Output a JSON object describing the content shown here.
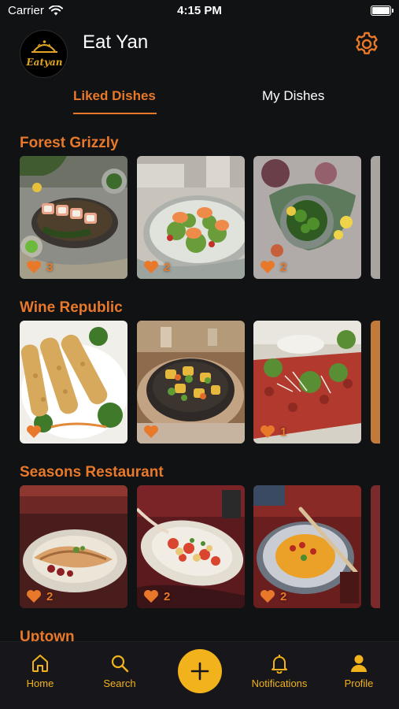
{
  "status_bar": {
    "carrier": "Carrier",
    "time": "4:15 PM"
  },
  "header": {
    "title": "Eat Yan",
    "logo_text": "Eatyan"
  },
  "tabs": [
    {
      "label": "Liked Dishes",
      "active": true
    },
    {
      "label": "My Dishes",
      "active": false
    }
  ],
  "sections": [
    {
      "name": "Forest Grizzly",
      "cards": [
        {
          "likes": "3"
        },
        {
          "likes": "2"
        },
        {
          "likes": "2"
        }
      ]
    },
    {
      "name": "Wine Republic",
      "cards": [
        {
          "likes": ""
        },
        {
          "likes": ""
        },
        {
          "likes": "1"
        }
      ]
    },
    {
      "name": "Seasons Restaurant",
      "cards": [
        {
          "likes": "2"
        },
        {
          "likes": "2"
        },
        {
          "likes": "2"
        }
      ]
    },
    {
      "name": "Uptown",
      "cards": []
    }
  ],
  "bottom_nav": {
    "home": "Home",
    "search": "Search",
    "add_icon": "plus-icon",
    "notifications": "Notifications",
    "profile": "Profile"
  },
  "colors": {
    "accent": "#e8782a",
    "nav_accent": "#f2b21b",
    "background": "#111214"
  }
}
